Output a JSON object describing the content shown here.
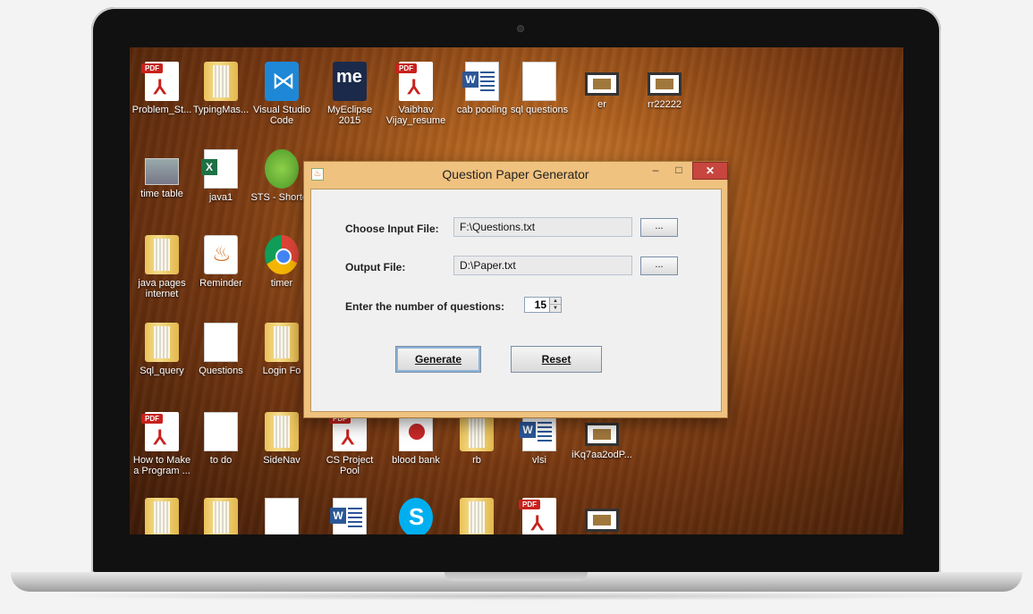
{
  "desktop": {
    "icons": [
      {
        "label": "Problem_St...",
        "icon": "pdf-icon"
      },
      {
        "label": "TypingMas...",
        "icon": "folder-icon"
      },
      {
        "label": "Visual Studio Code",
        "icon": "vscode-icon"
      },
      {
        "label": "MyEclipse 2015",
        "icon": "myeclipse-icon"
      },
      {
        "label": "Vaibhav Vijay_resume",
        "icon": "pdf-icon"
      },
      {
        "label": "cab pooling",
        "icon": "word-doc-icon"
      },
      {
        "label": "sql questions",
        "icon": "text-doc-icon"
      },
      {
        "label": "er",
        "icon": "slide-icon"
      },
      {
        "label": "rr22222",
        "icon": "slide-icon"
      },
      {
        "label": "time table",
        "icon": "photo-icon"
      },
      {
        "label": "java1",
        "icon": "excel-icon"
      },
      {
        "label": "STS - Shortcu",
        "icon": "spring-icon"
      },
      {
        "label": "java pages internet",
        "icon": "folder-icon"
      },
      {
        "label": "Reminder",
        "icon": "java-icon"
      },
      {
        "label": "timer",
        "icon": "chrome-icon"
      },
      {
        "label": "Sql_query",
        "icon": "folder-icon"
      },
      {
        "label": "Questions",
        "icon": "text-doc-icon"
      },
      {
        "label": "Login Fo",
        "icon": "folder-icon"
      },
      {
        "label": "How to Make a Program ...",
        "icon": "pdf-icon"
      },
      {
        "label": "to do",
        "icon": "text-doc-icon"
      },
      {
        "label": "SideNav",
        "icon": "folder-icon"
      },
      {
        "label": "CS Project Pool",
        "icon": "pdf-icon"
      },
      {
        "label": "blood bank",
        "icon": "blood-bank-icon"
      },
      {
        "label": "rb",
        "icon": "folder-icon"
      },
      {
        "label": "vlsi",
        "icon": "word-doc-icon"
      },
      {
        "label": "iKq7aa2odP...",
        "icon": "slide-icon"
      }
    ]
  },
  "window": {
    "title": "Question Paper Generator",
    "minimize": "–",
    "maximize": "□",
    "close": "✕"
  },
  "form": {
    "input_label": "Choose Input File:",
    "input_value": "F:\\Questions.txt",
    "input_browse": "...",
    "output_label": "Output File:",
    "output_value": "D:\\Paper.txt",
    "output_browse": "...",
    "count_label": "Enter the number of questions:",
    "count_value": "15",
    "generate_label": "Generate",
    "reset_label": "Reset"
  },
  "colors": {
    "titlebar": "#f0c27f",
    "close_button": "#c7463f",
    "dialog_background": "#f0f0f0"
  }
}
